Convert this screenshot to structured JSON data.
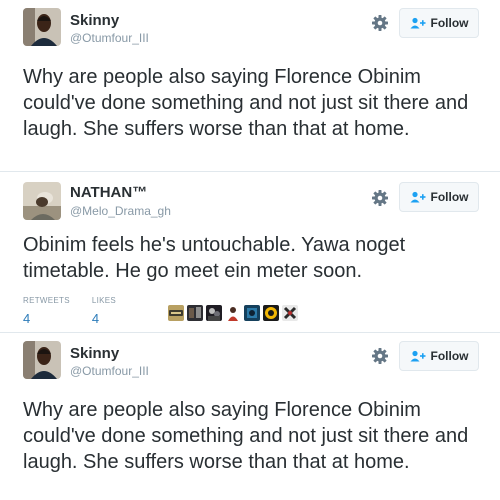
{
  "tweets": [
    {
      "name": "Skinny",
      "handle": "@Otumfour_III",
      "follow_label": "Follow",
      "text": "Why are people also saying Florence Obinim could've done something and not just sit there and laugh. She suffers worse than that at home."
    },
    {
      "name": "NATHAN™",
      "handle": "@Melo_Drama_gh",
      "follow_label": "Follow",
      "text": "Obinim feels he's untouchable. Yawa noget timetable. He go meet ein meter soon.",
      "retweets_label": "RETWEETS",
      "retweets_count": "4",
      "likes_label": "LIKES",
      "likes_count": "4"
    },
    {
      "name": "Skinny",
      "handle": "@Otumfour_III",
      "follow_label": "Follow",
      "text": "Why are people also saying Florence Obinim could've done something and not just sit there and laugh. She suffers worse than that at home."
    }
  ],
  "icons": {
    "settings": "gear-icon",
    "follow": "follow-person-plus-icon"
  },
  "colors": {
    "text": "#292f33",
    "secondary": "#8899a6",
    "link": "#2b7bb9",
    "border": "#e1e8ed",
    "button_bg": "#f5f8fa"
  }
}
